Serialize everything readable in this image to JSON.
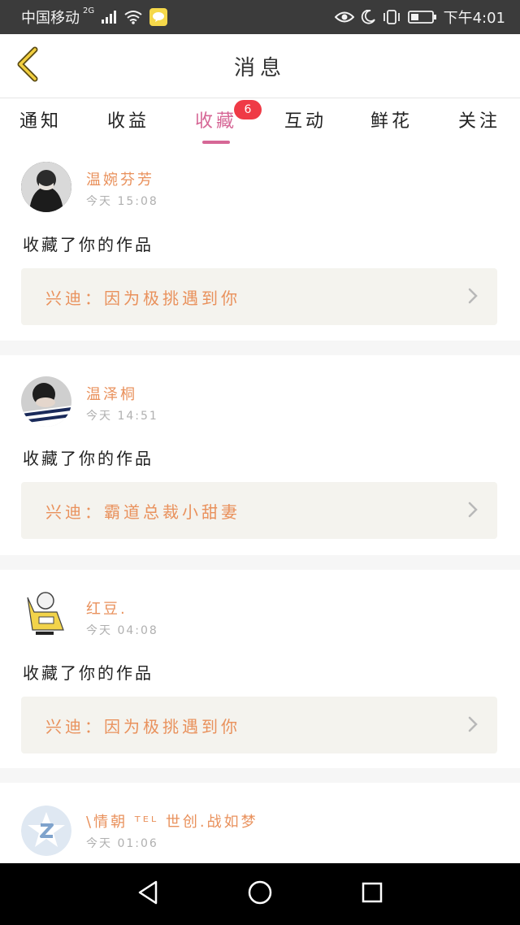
{
  "status_bar": {
    "carrier": "中国移动",
    "network": "2G",
    "time": "下午4:01",
    "icons": [
      "signal-icon",
      "wifi-icon",
      "chat-app-icon",
      "eye-icon",
      "moon-icon",
      "vibrate-icon",
      "battery-icon"
    ]
  },
  "header": {
    "title": "消息"
  },
  "tabs": [
    {
      "label": "通知"
    },
    {
      "label": "收益"
    },
    {
      "label": "收藏",
      "badge": "6",
      "active": true
    },
    {
      "label": "互动"
    },
    {
      "label": "鲜花"
    },
    {
      "label": "关注"
    }
  ],
  "items": [
    {
      "name": "温婉芬芳",
      "time": "今天 15:08",
      "action": "收藏了你的作品",
      "work": "兴迪：因为极挑遇到你"
    },
    {
      "name": "温泽桐",
      "time": "今天 14:51",
      "action": "收藏了你的作品",
      "work": "兴迪：霸道总裁小甜妻"
    },
    {
      "name": "红豆.",
      "time": "今天 04:08",
      "action": "收藏了你的作品",
      "work": "兴迪：因为极挑遇到你"
    },
    {
      "name": "\\情朝 ᵀᴱᴸ 世创.战如梦",
      "time": "今天 01:06"
    }
  ],
  "colors": {
    "accent_pink": "#d66796",
    "name_orange": "#e9915c",
    "badge_red": "#ef3a46"
  }
}
